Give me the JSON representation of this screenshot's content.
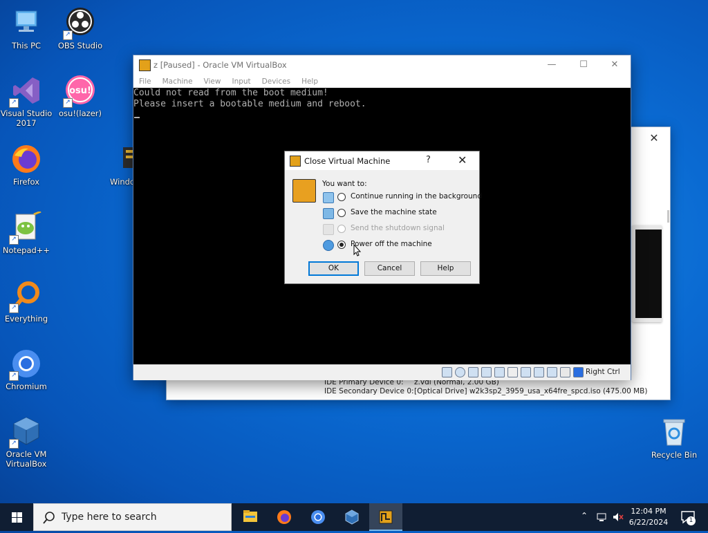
{
  "desktop": {
    "icons": [
      {
        "label": "This PC",
        "icon": "this-pc-icon"
      },
      {
        "label": "OBS Studio",
        "icon": "obs-studio-icon"
      },
      {
        "label": "Visual Studio 2017",
        "icon": "visual-studio-icon"
      },
      {
        "label": "osu!(lazer)",
        "icon": "osu-icon",
        "badge_text": "osu!"
      },
      {
        "label": "Firefox",
        "icon": "firefox-icon"
      },
      {
        "label": "Windo",
        "icon": "windows-app-icon"
      },
      {
        "label": "Notepad++",
        "icon": "notepad-plus-plus-icon"
      },
      {
        "label": "Everything",
        "icon": "everything-search-icon"
      },
      {
        "label": "Chromium",
        "icon": "chromium-icon"
      },
      {
        "label": "Oracle VM VirtualBox",
        "icon": "virtualbox-icon"
      },
      {
        "label": "Recycle Bin",
        "icon": "recycle-bin-icon"
      }
    ]
  },
  "back_window": {
    "devices": [
      {
        "label": "IDE Primary Device 0:",
        "value": "z.vdi (Normal, 2.00 GB)"
      },
      {
        "label": "IDE Secondary Device 0:",
        "value": "[Optical Drive] w2k3sp2_3959_usa_x64fre_spcd.iso (475.00 MB)"
      }
    ]
  },
  "vm_window": {
    "title": "z [Paused] - Oracle VM VirtualBox",
    "menu": [
      "File",
      "Machine",
      "View",
      "Input",
      "Devices",
      "Help"
    ],
    "console_lines": [
      "Could not read from the boot medium!",
      "Please insert a bootable medium and reboot."
    ],
    "host_key_label": "Right Ctrl"
  },
  "dialog": {
    "title": "Close Virtual Machine",
    "help_glyph": "?",
    "prompt": "You want to:",
    "options": [
      {
        "label": "Continue running in the background",
        "selected": false,
        "enabled": true
      },
      {
        "label": "Save the machine state",
        "selected": false,
        "enabled": true
      },
      {
        "label": "Send the shutdown signal",
        "selected": false,
        "enabled": false
      },
      {
        "label": "Power off the machine",
        "selected": true,
        "enabled": true
      }
    ],
    "buttons": {
      "ok": "OK",
      "cancel": "Cancel",
      "help": "Help"
    }
  },
  "taskbar": {
    "search_placeholder": "Type here to search",
    "time": "12:04 PM",
    "date": "6/22/2024",
    "notification_count": "1",
    "apps": [
      "file-explorer-icon",
      "firefox-icon",
      "chromium-icon",
      "virtualbox-icon",
      "virtualbox-vm-icon"
    ]
  },
  "colors": {
    "desktop_blue": "#0a6ad2",
    "taskbar": "#101e33",
    "accent": "#0078d7"
  }
}
